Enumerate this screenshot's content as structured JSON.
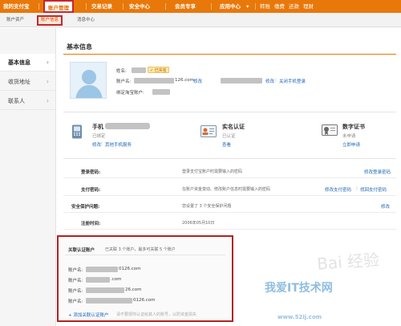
{
  "topnav": {
    "items": [
      "我的支付宝",
      "账户管理",
      "交易记录",
      "安全中心",
      "会员专享",
      "应用中心"
    ],
    "quick_links": [
      "转账",
      "缴费",
      "还款",
      "理财"
    ]
  },
  "subnav": {
    "items": [
      "账户资产",
      "账户信息",
      "消息中心"
    ]
  },
  "sidebar": {
    "items": [
      "基本信息",
      "收货地址",
      "联系人"
    ]
  },
  "page": {
    "title": "基本信息"
  },
  "profile": {
    "name_label": "姓名:",
    "auth_badge": "已实名",
    "account_label": "账户名:",
    "account_suffix": "126.com",
    "modify_link": "修改",
    "close_phone_login": "关闭手机登录",
    "taobao_label": "绑定淘宝账户:"
  },
  "cards": {
    "phone": {
      "title": "手机",
      "status": "已绑定",
      "modify": "修改",
      "other": "其他手机服务"
    },
    "realname": {
      "title": "实名认证",
      "status": "已认证",
      "view": "查看"
    },
    "cert": {
      "title": "数字证书",
      "status": "未申请",
      "apply": "立即申请"
    }
  },
  "security": {
    "login_pwd": {
      "label": "登录密码:",
      "desc": "登录支付宝账户时需要输入的密码",
      "action": "修改登录密码"
    },
    "pay_pwd": {
      "label": "支付密码:",
      "desc": "在账户资金变动、修改账户信息时需要输入的密码",
      "action_modify": "修改支付密码",
      "action_reset": "找回支付密码"
    },
    "question": {
      "label": "安全保护问题:",
      "desc": "您设置了 3 个安全保护问题",
      "action": "修改"
    },
    "reg_time": {
      "label": "注册时间:",
      "value": "2006年05月10日"
    }
  },
  "linked": {
    "title": "关联认证账户",
    "desc": "已关联 3 个账户，最多可关联 5 个账户",
    "accounts": [
      {
        "label": "账户名:",
        "suffix": "0126.com"
      },
      {
        "label": "账户名:",
        "suffix": ".com"
      },
      {
        "label": "账户名:",
        "suffix": "26.com"
      },
      {
        "label": "账户名:",
        "suffix": "0126.com"
      }
    ],
    "add_link": "+ 添加关联认证账户",
    "note": "请不要把你认证给其人的账号，以防资金损失"
  },
  "watermark": {
    "main": "我爱IT技术网",
    "url": "www.52ij.com",
    "baidu": "Bai 经验"
  }
}
